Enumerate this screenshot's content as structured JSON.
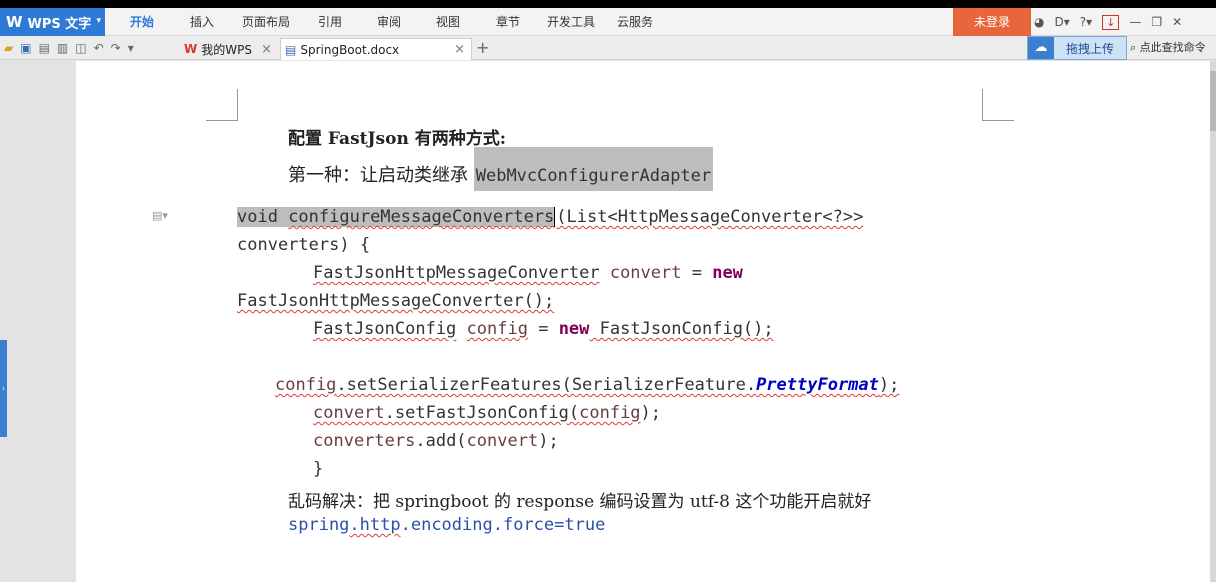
{
  "app": {
    "name": "WPS 文字",
    "logo": "W",
    "menu": [
      "开始",
      "插入",
      "页面布局",
      "引用",
      "审阅",
      "视图",
      "章节",
      "开发工具",
      "云服务"
    ],
    "active_menu": "开始",
    "login": "未登录"
  },
  "tabs": [
    {
      "label": "我的WPS",
      "icon": "wps-logo-icon"
    },
    {
      "label": "SpringBoot.docx",
      "icon": "document-icon"
    }
  ],
  "cloud_upload": "拖拽上传",
  "search_command": "点此查找命令",
  "document": {
    "heading": "配置 FastJson 有两种方式:",
    "way1_text": "第一种：让启动类继承 ",
    "way1_class": "WebMvcConfigurerAdapter",
    "code": {
      "l1_kw": "void ",
      "l1_method": "configureMessageConverters",
      "l1_rest": "(List<HttpMessageConverter<?>>",
      "l2": "converters) {",
      "l3_type": "FastJsonHttpMessageConverter",
      "l3_var": "convert",
      "l3_eq": " = ",
      "l3_new": "new",
      "l4": "FastJsonHttpMessageConverter();",
      "l5_type": "FastJsonConfig",
      "l5_var": "config",
      "l5_eq": " = ",
      "l5_new": "new",
      "l5_rest": " FastJsonConfig();",
      "l6_var": "config",
      "l6_mid": ".setSerializerFeatures(SerializerFeature.",
      "l6_const": "PrettyFormat",
      "l6_end": ");",
      "l7_var": "convert",
      "l7_mid": ".setFastJsonConfig(",
      "l7_arg": "config",
      "l7_end": ");",
      "l8_var": "converters",
      "l8_mid": ".add(",
      "l8_arg": "convert",
      "l8_end": ");",
      "l9": "}"
    },
    "garble_fix": "乱码解决：把 springboot 的 response 编码设置为 utf-8 这个功能开启就好",
    "property": {
      "a": "spring",
      "b": ".http",
      "c": ".encoding",
      "d": ".force",
      "e": "=true"
    }
  }
}
